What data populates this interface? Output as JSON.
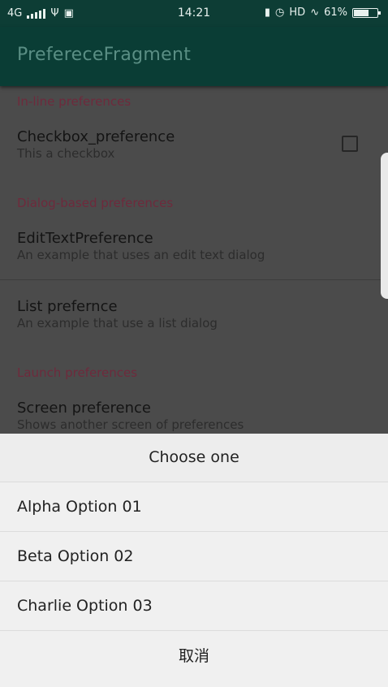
{
  "status": {
    "network": "4G",
    "time": "14:21",
    "hd": "HD",
    "battery": "61%"
  },
  "appbar": {
    "title": "PreferecеFragment"
  },
  "prefs": {
    "cat_inline": "In-line preferences",
    "checkbox_title": "Checkbox_preference",
    "checkbox_summary": "This a checkbox",
    "cat_dialog": "Dialog-based preferences",
    "edittext_title": "EditTextPreference",
    "edittext_summary": "An example that uses an edit text dialog",
    "list_title": "List prefernce",
    "list_summary": "An example that use a list dialog",
    "cat_launch": "Launch preferences",
    "screen_title": "Screen preference",
    "screen_summary": "Shows another screen of preferences"
  },
  "dialog": {
    "title": "Choose one",
    "options": [
      "Alpha Option 01",
      "Beta Option 02",
      "Charlie Option 03"
    ],
    "cancel": "取消"
  }
}
